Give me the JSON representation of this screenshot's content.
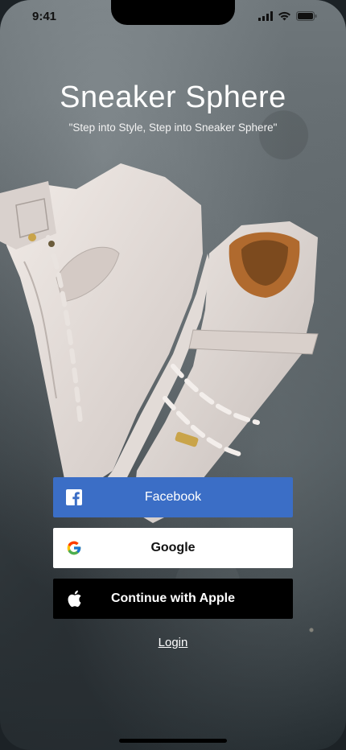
{
  "status_bar": {
    "time": "9:41",
    "icons": [
      "signal-icon",
      "wifi-icon",
      "battery-icon"
    ]
  },
  "app": {
    "title": "Sneaker Sphere",
    "tagline": "\"Step into Style, Step into Sneaker Sphere\""
  },
  "auth": {
    "facebook_label": "Facebook",
    "google_label": "Google",
    "apple_label": "Continue with Apple",
    "login_label": "Login"
  },
  "colors": {
    "facebook": "#3b6ec6",
    "google_bg": "#ffffff",
    "apple_bg": "#000000",
    "text_light": "#ffffff"
  },
  "illustration": {
    "subject": "sneakers-image"
  }
}
